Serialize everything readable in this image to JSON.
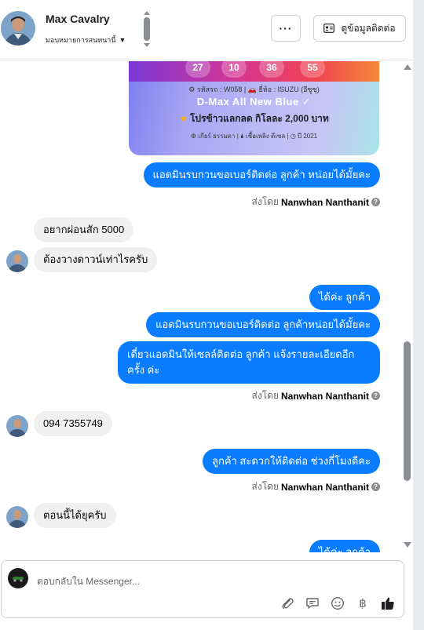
{
  "header": {
    "name": "Max Cavalry",
    "assign_label": "มอบหมายการสนทนานี้",
    "more_label": "···",
    "contact_button_label": "ดูข้อมูลติดต่อ"
  },
  "card": {
    "numbers": [
      "27",
      "10",
      "36",
      "55"
    ],
    "line1": "⚙ รหัสรถ : W058 | 🚗 ยี่ห้อ : ISUZU (อีซูซุ)",
    "title": "D-Max All New Blue ✓",
    "promo": "โปรข้าวแลกลด กิโลละ 2,000 บาท",
    "specs": "⚙ เกียร์ ธรรมดา  |  🌢 เชื้อเพลิง ดีเซล  |  ◷ ปี 2021"
  },
  "messages": [
    {
      "dir": "out",
      "text": "แอดมินรบกวนขอเบอร์ติดต่อ ลูกค้า หน่อยได้มั้ยคะ"
    },
    {
      "dir": "in",
      "text": "อยากผ่อนสัก 5000"
    },
    {
      "dir": "in",
      "text": "ต้องวางดาวน์เท่าไรครับ"
    },
    {
      "dir": "out",
      "text": "ได้ค่ะ  ลูกค้า"
    },
    {
      "dir": "out",
      "text": "แอดมินรบกวนขอเบอร์ติดต่อ ลูกค้าหน่อยได้มั้ยคะ"
    },
    {
      "dir": "out",
      "text_line1": "เดี๋ยวแอดมินให้เซลล์ติดต่อ ลูกค้า แจ้งรายละเอียดอีก",
      "text_line2": "ครั้ง ค่ะ"
    },
    {
      "dir": "in",
      "text": "094 7355749"
    },
    {
      "dir": "out",
      "text": "ลูกค้า สะดวกให้ติดต่อ ช่วงกี่โมงดีคะ"
    },
    {
      "dir": "in",
      "text": "ตอนนี้ได้ยุครับ"
    },
    {
      "dir": "out",
      "text": "ได้ค่ะ  ลูกค้า"
    }
  ],
  "sent_by": {
    "prefix": "ส่งโดย",
    "agent": "Nanwhan Nanthanit",
    "help": "?"
  },
  "composer": {
    "placeholder": "ตอบกลับใน Messenger..."
  },
  "colors": {
    "outgoing_bubble": "#0a7cff",
    "incoming_bubble": "#f0f0f0"
  }
}
